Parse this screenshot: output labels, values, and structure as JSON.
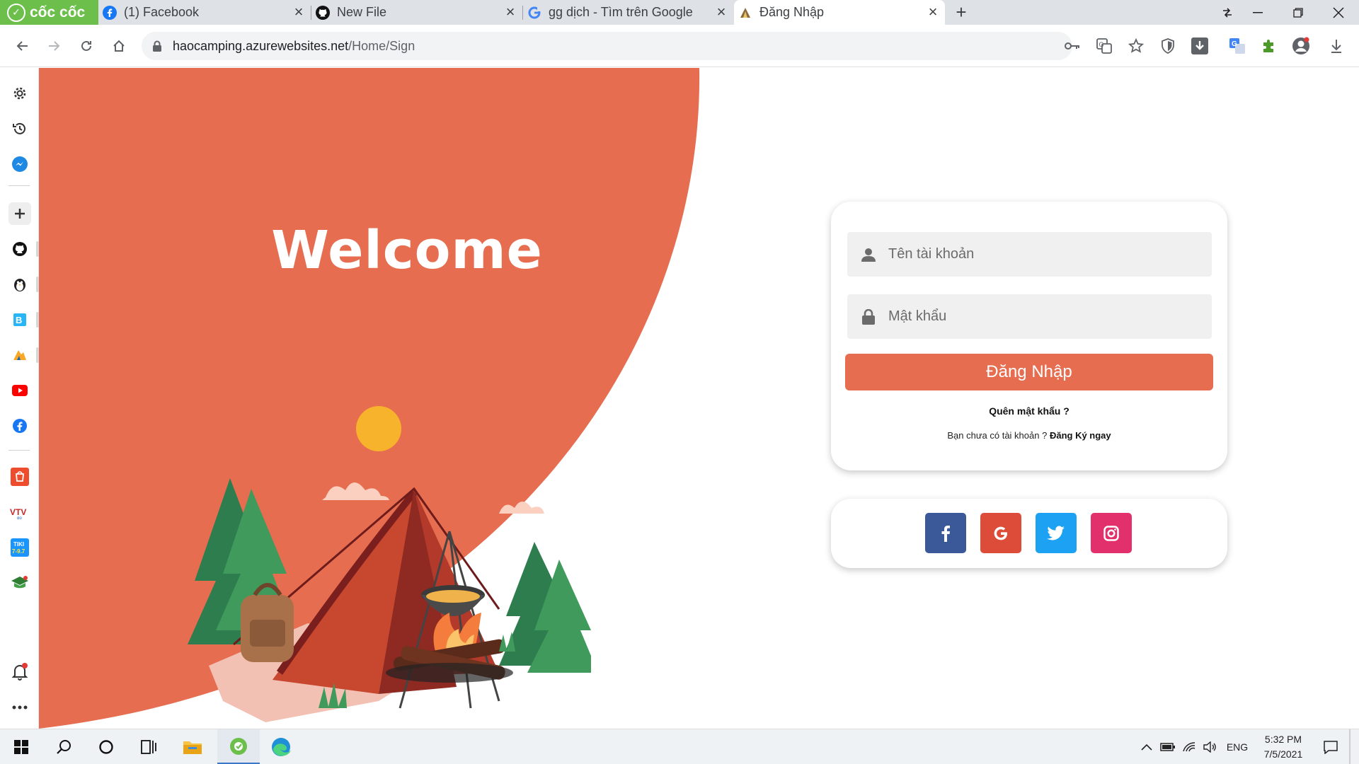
{
  "browser": {
    "brand_label": "cốc cốc",
    "tabs": [
      {
        "title": "(1) Facebook",
        "icon": "facebook-icon"
      },
      {
        "title": "New File",
        "icon": "github-icon"
      },
      {
        "title": "gg dịch - Tìm trên Google",
        "icon": "google-icon"
      },
      {
        "title": "Đăng Nhập",
        "icon": "camping-favicon"
      }
    ],
    "active_tab_index": 3,
    "url_host": "haocamping.azurewebsites.net",
    "url_path": "/Home/Sign"
  },
  "hero": {
    "heading": "Welcome",
    "background_color": "#e66d4f"
  },
  "login": {
    "username_placeholder": "Tên tài khoản",
    "password_placeholder": "Mật khẩu",
    "submit_label": "Đăng Nhập",
    "forgot_label": "Quên mật khẩu ?",
    "no_account_text": "Bạn chưa có tài khoản ?",
    "signup_link": "Đăng Ký ngay"
  },
  "social": [
    {
      "name": "facebook",
      "color": "#3b5998"
    },
    {
      "name": "google",
      "color": "#dd4b39"
    },
    {
      "name": "twitter",
      "color": "#1da1f2"
    },
    {
      "name": "instagram",
      "color": "#e1306c"
    }
  ],
  "taskbar": {
    "language": "ENG",
    "time": "5:32 PM",
    "date": "7/5/2021"
  }
}
